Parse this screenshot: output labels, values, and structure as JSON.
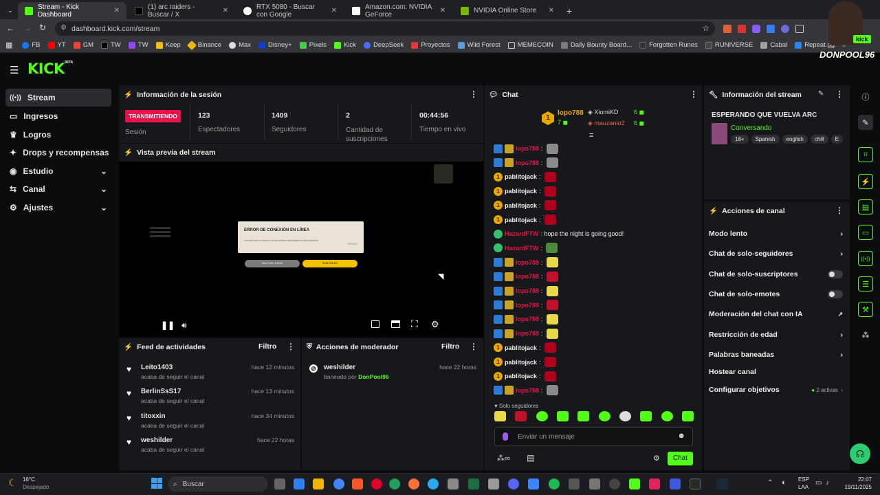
{
  "browser": {
    "tabs": [
      {
        "title": "Stream - Kick Dashboard",
        "active": true,
        "favicon_color": "#53fc18"
      },
      {
        "title": "(1) arc raiders - Buscar / X",
        "favicon_color": "#000000"
      },
      {
        "title": "RTX 5080 - Buscar con Google",
        "favicon_color": "#4285f4"
      },
      {
        "title": "Amazon.com: NVIDIA GeForce",
        "favicon_color": "#ff9900"
      },
      {
        "title": "NVIDIA Online Store",
        "favicon_color": "#76b900"
      }
    ],
    "url": "dashboard.kick.com/stream",
    "bookmarks": [
      "FB",
      "YT",
      "GM",
      "TW",
      "TW",
      "Keep",
      "Binance",
      "Max",
      "Disney+",
      "Pixels",
      "Kick",
      "DeepSeek",
      "Proyectos",
      "Wild Forest",
      "MEMECOIN",
      "Daily Bounty Board...",
      "Forgotten Runes",
      "RUNIVERSE",
      "Cabal",
      "Repeat.gg"
    ]
  },
  "kick": {
    "logo": "KICK",
    "logo_badge": "BETA",
    "accent": "#53fc18",
    "live_red": "#e8134a"
  },
  "sidebar": {
    "items": [
      {
        "label": "Stream",
        "icon": "broadcast-icon"
      },
      {
        "label": "Ingresos",
        "icon": "card-icon"
      },
      {
        "label": "Logros",
        "icon": "trophy-icon"
      },
      {
        "label": "Drops y recompensas",
        "icon": "gift-icon"
      },
      {
        "label": "Estudio",
        "icon": "studio-icon"
      },
      {
        "label": "Canal",
        "icon": "channel-icon"
      },
      {
        "label": "Ajustes",
        "icon": "gear-icon"
      }
    ]
  },
  "session": {
    "title": "Información de la sesión",
    "status": "TRANSMITIENDO",
    "status_label": "Sesión",
    "stats": [
      {
        "value": "123",
        "label": "Espectadores"
      },
      {
        "value": "1409",
        "label": "Seguidores"
      },
      {
        "value": "2",
        "label": "Cantidad de suscripciones"
      },
      {
        "value": "00:44:56",
        "label": "Tiempo en vivo"
      }
    ]
  },
  "preview": {
    "title": "Vista previa del stream",
    "error_title": "ERROR DE CONEXIÓN EN LÍNEA",
    "error_body": "Los servicios en línea no se encuentran disponibles en este momento",
    "error_code": "ERR:001",
    "btn_left": "SALIR DEL JUEGO",
    "btn_right": "REINTENTAR"
  },
  "feed": {
    "title": "Feed de actividades",
    "filter": "Filtro",
    "items": [
      {
        "user": "Leito1403",
        "action": "acaba de seguir el canal",
        "time": "hace 12 minutos"
      },
      {
        "user": "BerlinSsS17",
        "action": "acaba de seguir el canal",
        "time": "hace 13 minutos"
      },
      {
        "user": "titoxxin",
        "action": "acaba de seguir el canal",
        "time": "hace 34 minutos"
      },
      {
        "user": "weshilder",
        "action": "acaba de seguir el canal",
        "time": "hace 22 horas"
      }
    ]
  },
  "mod": {
    "title": "Acciones de moderador",
    "filter": "Filtro",
    "items": [
      {
        "user": "weshilder",
        "action": "baneado por",
        "by": "DonPool96",
        "time": "hace 22 horas"
      }
    ]
  },
  "chat": {
    "title": "Chat",
    "top": [
      {
        "rank": "1",
        "user": "lopo788",
        "count": "7"
      },
      {
        "user": "XiomiKD",
        "count": "6"
      },
      {
        "user": "mauzanlo2",
        "count": "6"
      }
    ],
    "messages": [
      {
        "user": "lopo788",
        "badges": "sub",
        "text": ":",
        "emote": "#8a8a8a"
      },
      {
        "user": "lopo788",
        "badges": "sub",
        "text": ":",
        "emote": "#8a8a8a"
      },
      {
        "user": "pablitojack",
        "badges": "coin",
        "text": ":",
        "emote": "#b00020"
      },
      {
        "user": "pablitojack",
        "badges": "coin",
        "text": ":",
        "emote": "#b00020"
      },
      {
        "user": "pablitojack",
        "badges": "coin",
        "text": ":",
        "emote": "#b00020"
      },
      {
        "user": "pablitojack",
        "badges": "coin",
        "text": ":",
        "emote": "#b00020"
      },
      {
        "user": "HazardFTW",
        "badges": "ver",
        "text": ": hope the night is going good!",
        "emote": ""
      },
      {
        "user": "HazardFTW",
        "badges": "ver",
        "text": ":",
        "emote": "#4a8a3a"
      },
      {
        "user": "lopo788",
        "badges": "sub",
        "text": ":",
        "emote": "#e8d84a"
      },
      {
        "user": "lopo788",
        "badges": "sub",
        "text": ":",
        "emote": "#c0102a"
      },
      {
        "user": "lopo788",
        "badges": "sub",
        "text": ":",
        "emote": "#e8d84a"
      },
      {
        "user": "lopo788",
        "badges": "sub",
        "text": ":",
        "emote": "#c0102a"
      },
      {
        "user": "lopo788",
        "badges": "sub",
        "text": ":",
        "emote": "#e8d84a"
      },
      {
        "user": "lopo788",
        "badges": "sub",
        "text": ":",
        "emote": "#e8d84a"
      },
      {
        "user": "pablitojack",
        "badges": "coin",
        "text": ":",
        "emote": "#b00020"
      },
      {
        "user": "pablitojack",
        "badges": "coin",
        "text": ":",
        "emote": "#b00020"
      },
      {
        "user": "pablitojack",
        "badges": "coin",
        "text": ":",
        "emote": "#b00020"
      },
      {
        "user": "lopo788",
        "badges": "sub",
        "text": ":",
        "emote": "#8a8a8a"
      }
    ],
    "followers_only": "Solo seguidores",
    "placeholder": "Enviar un mensaje",
    "send": "Chat"
  },
  "stream_info": {
    "title": "Información del stream",
    "stream_title": "ESPERANDO QUE VUELVA ARC",
    "category": "Conversando",
    "tags": [
      "18+",
      "Spanish",
      "english",
      "chill",
      "E"
    ]
  },
  "channel_actions": {
    "title": "Acciones de canal",
    "items": [
      {
        "label": "Modo lento",
        "type": "chevron"
      },
      {
        "label": "Chat de solo-seguidores",
        "type": "chevron"
      },
      {
        "label": "Chat de solo-suscriptores",
        "type": "toggle"
      },
      {
        "label": "Chat de solo-emotes",
        "type": "toggle"
      },
      {
        "label": "Moderación del chat con IA",
        "type": "external"
      },
      {
        "label": "Restricción de edad",
        "type": "chevron"
      },
      {
        "label": "Palabras baneadas",
        "type": "chevron"
      },
      {
        "label": "Hostear canal",
        "type": "none"
      },
      {
        "label": "Configurar objetivos",
        "type": "goals",
        "extra": "2 activas"
      }
    ]
  },
  "overlay": {
    "name": "DONPOOL96",
    "badge": "kick"
  },
  "taskbar": {
    "temp": "16°C",
    "weather": "Despejado",
    "search": "Buscar",
    "lang": "ESP",
    "lang2": "LAA",
    "time": "22:07",
    "date": "19/11/2025"
  }
}
